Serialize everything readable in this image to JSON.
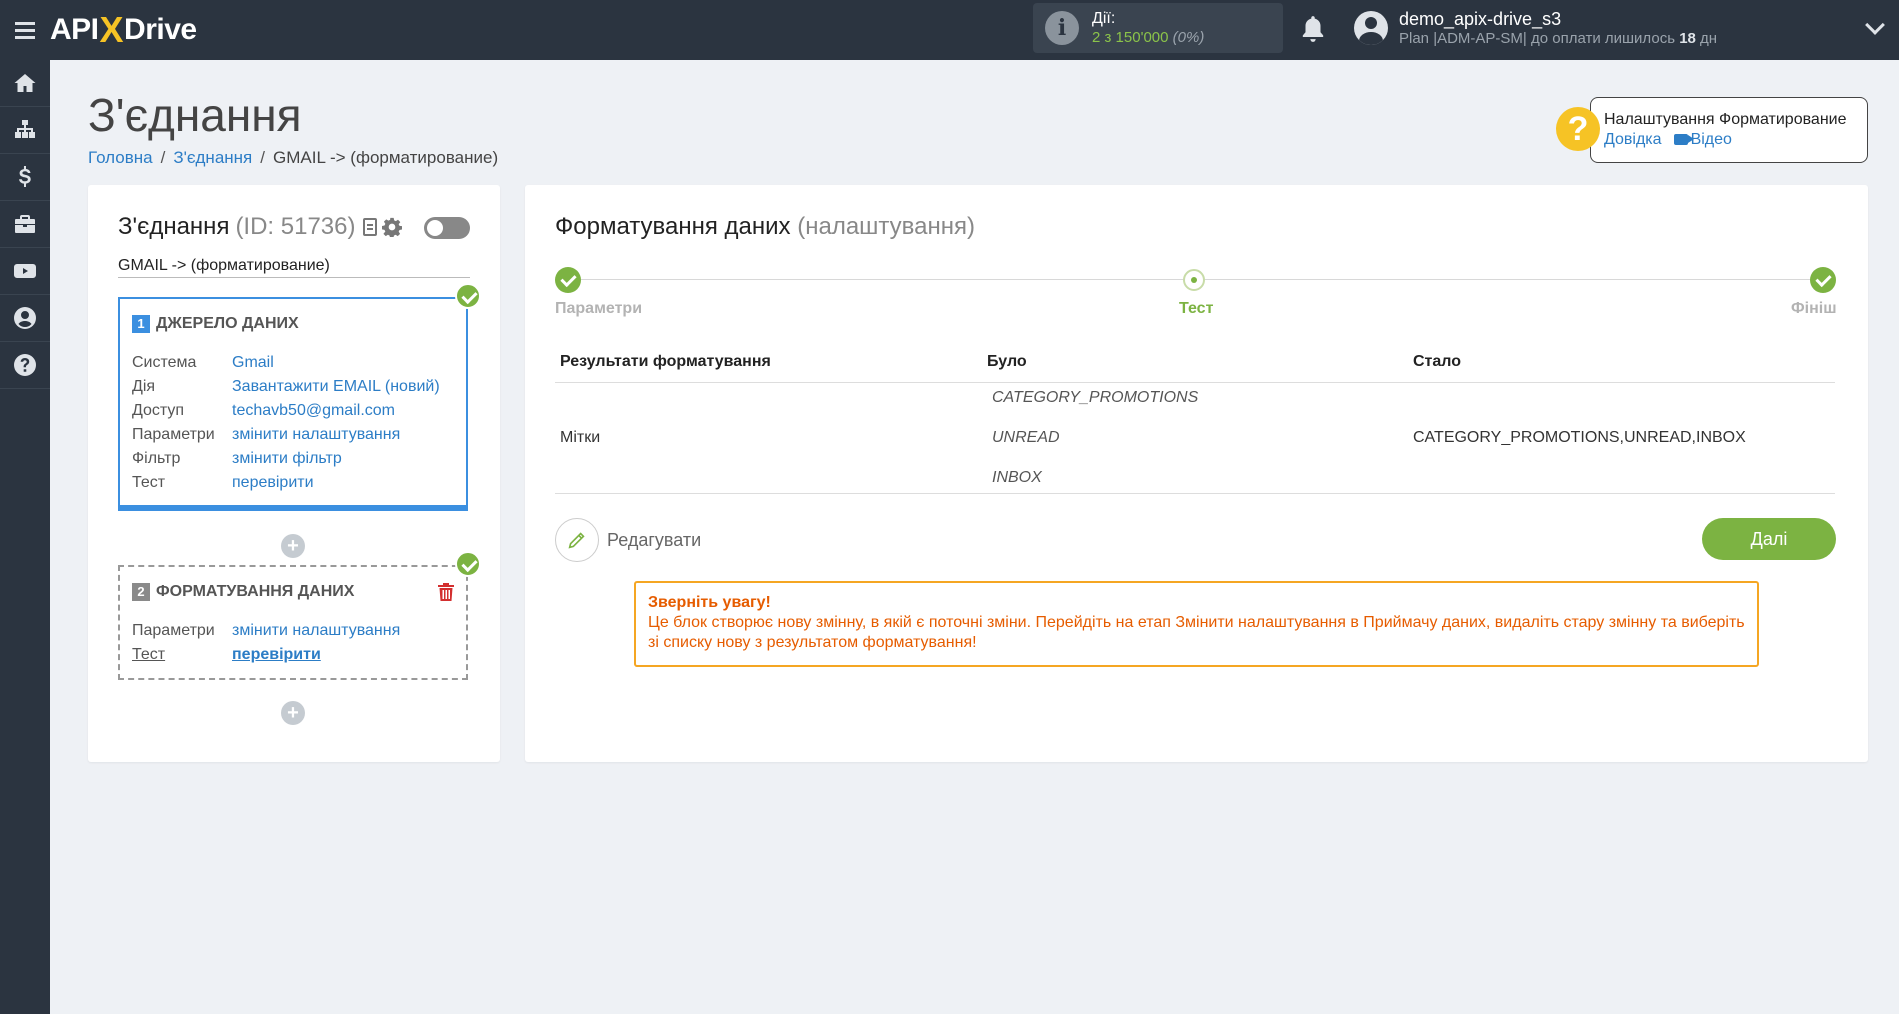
{
  "topbar": {
    "logo_api": "API",
    "logo_x": "X",
    "logo_drive": "Drive",
    "actions_label": "Дії:",
    "actions_count": "2 з 150'000",
    "actions_percent": "(0%)",
    "user_name": "demo_apix-drive_s3",
    "plan_prefix": "Plan |ADM-AP-SM| до оплати лишилось ",
    "plan_days": "18",
    "plan_suffix": " дн"
  },
  "sidebar": {
    "icons": [
      "home-icon",
      "sitemap-icon",
      "dollar-icon",
      "briefcase-icon",
      "youtube-icon",
      "user-icon",
      "help-icon"
    ]
  },
  "page": {
    "title": "З'єднання",
    "breadcrumb": [
      "Головна",
      "З'єднання",
      "GMAIL -> (форматирование)"
    ]
  },
  "help": {
    "title": "Налаштування Форматирование",
    "link_help": "Довідка",
    "link_video": "Відео"
  },
  "connection": {
    "title": "З'єднання",
    "id": "(ID: 51736)",
    "name": "GMAIL -> (форматирование)",
    "block1": {
      "number": "1",
      "title": "ДЖЕРЕЛО ДАНИХ",
      "rows": [
        {
          "key": "Система",
          "value": "Gmail"
        },
        {
          "key": "Дія",
          "value": "Завантажити EMAIL (новий)"
        },
        {
          "key": "Доступ",
          "value": "techavb50@gmail.com"
        },
        {
          "key": "Параметри",
          "value": "змінити налаштування"
        },
        {
          "key": "Фільтр",
          "value": "змінити фільтр"
        },
        {
          "key": "Тест",
          "value": "перевірити"
        }
      ]
    },
    "block2": {
      "number": "2",
      "title": "ФОРМАТУВАННЯ ДАНИХ",
      "rows": [
        {
          "key": "Параметри",
          "value": "змінити налаштування"
        },
        {
          "key": "Тест",
          "value": "перевірити"
        }
      ]
    }
  },
  "formatting": {
    "title": "Форматування даних",
    "subtitle": "(налаштування)",
    "steps": [
      "Параметри",
      "Тест",
      "Фініш"
    ],
    "table": {
      "headers": [
        "Результати форматування",
        "Було",
        "Стало"
      ],
      "row": {
        "label": "Мітки",
        "was": [
          "CATEGORY_PROMOTIONS",
          "UNREAD",
          "INBOX"
        ],
        "became": "CATEGORY_PROMOTIONS,UNREAD,INBOX"
      }
    },
    "edit_label": "Редагувати",
    "next_label": "Далі",
    "warning_title": "Зверніть увагу!",
    "warning_text": "Це блок створює нову змінну, в якій є поточні зміни. Перейдіть на етап Змінити налаштування в Приймачу даних, видаліть стару змінну та виберіть зі списку нову з результатом форматування!"
  },
  "colors": {
    "topbar": "#2b3440",
    "accent_green": "#7cb342",
    "link_blue": "#2c7dc6",
    "warning_orange": "#e65c00",
    "logo_yellow": "#f6c325"
  }
}
